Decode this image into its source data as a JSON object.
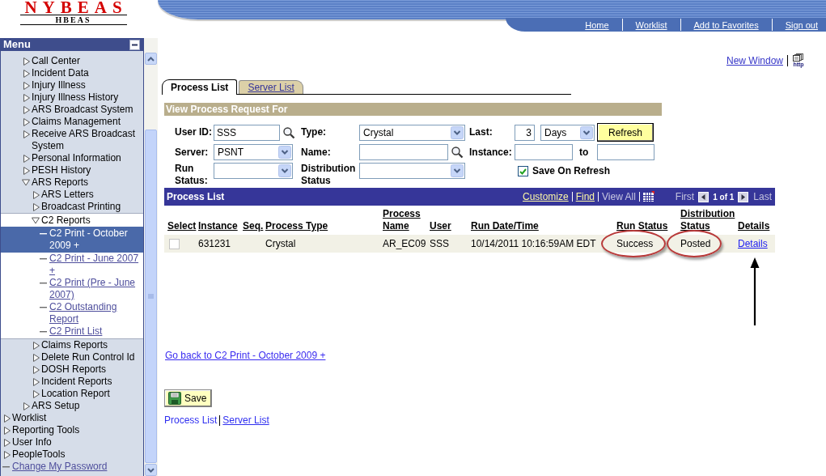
{
  "header": {
    "logo_title": "NYBEAS",
    "logo_subtitle": "HBEAS",
    "nav_links": [
      "Home",
      "Worklist",
      "Add to Favorites",
      "Sign out"
    ]
  },
  "sidebar": {
    "title": "Menu",
    "items": [
      {
        "children": [
          {
            "label": "Call Center",
            "kind": "folder",
            "expanded": false,
            "selected": false
          },
          {
            "label": "Incident Data",
            "kind": "folder",
            "expanded": false,
            "selected": false
          },
          {
            "label": "Injury Illness",
            "kind": "folder",
            "expanded": false,
            "selected": false
          },
          {
            "label": "Injury Illness History",
            "kind": "folder",
            "expanded": false,
            "selected": false
          },
          {
            "label": "ARS Broadcast System",
            "kind": "folder",
            "expanded": false,
            "selected": false
          },
          {
            "label": "Claims Management",
            "kind": "folder",
            "expanded": false,
            "selected": false
          },
          {
            "label": "Receive ARS Broadcast System",
            "kind": "folder",
            "expanded": false,
            "selected": false
          },
          {
            "label": "Personal Information",
            "kind": "folder",
            "expanded": false,
            "selected": false
          },
          {
            "label": "PESH History",
            "kind": "folder",
            "expanded": false,
            "selected": false
          },
          {
            "label": "ARS Reports",
            "kind": "folder",
            "expanded": true,
            "selected": false,
            "children": [
              {
                "label": "ARS Letters",
                "kind": "folder",
                "expanded": false,
                "selected": false
              },
              {
                "label": "Broadcast Printing",
                "kind": "folder",
                "expanded": false,
                "selected": false
              },
              {
                "label": "C2 Reports",
                "kind": "folder",
                "expanded": true,
                "selected": false,
                "children": [
                  {
                    "label": "C2 Print - October 2009 +",
                    "kind": "link",
                    "selected": true
                  },
                  {
                    "label": "C2 Print - June 2007 +",
                    "kind": "link",
                    "selected": false
                  },
                  {
                    "label": "C2 Print (Pre - June 2007)",
                    "kind": "link",
                    "selected": false
                  },
                  {
                    "label": "C2 Outstanding Report",
                    "kind": "link",
                    "selected": false
                  },
                  {
                    "label": "C2 Print List",
                    "kind": "link",
                    "selected": false
                  }
                ]
              },
              {
                "label": "Claims Reports",
                "kind": "folder",
                "expanded": false,
                "selected": false
              },
              {
                "label": "Delete Run Control Id",
                "kind": "folder",
                "expanded": false,
                "selected": false
              },
              {
                "label": "DOSH Reports",
                "kind": "folder",
                "expanded": false,
                "selected": false
              },
              {
                "label": "Incident Reports",
                "kind": "folder",
                "expanded": false,
                "selected": false
              },
              {
                "label": "Location Report",
                "kind": "folder",
                "expanded": false,
                "selected": false
              }
            ]
          },
          {
            "label": "ARS Setup",
            "kind": "folder",
            "expanded": false,
            "selected": false
          }
        ]
      },
      {
        "label": "Worklist",
        "kind": "folder",
        "expanded": false,
        "selected": false
      },
      {
        "label": "Reporting Tools",
        "kind": "folder",
        "expanded": false,
        "selected": false
      },
      {
        "label": "User Info",
        "kind": "folder",
        "expanded": false,
        "selected": false
      },
      {
        "label": "PeopleTools",
        "kind": "folder",
        "expanded": false,
        "selected": false
      },
      {
        "label": "Change My Password",
        "kind": "link",
        "selected": false
      }
    ]
  },
  "new_window_link": "New Window",
  "http_link": "http",
  "tabs": [
    {
      "label": "Process List",
      "selected": true
    },
    {
      "label": "Server List",
      "selected": false
    }
  ],
  "filter_panel": {
    "title": "View Process Request For",
    "user_id": {
      "label": "User ID:",
      "value": "SSS"
    },
    "type": {
      "label": "Type:",
      "value": "Crystal"
    },
    "last": {
      "label": "Last:",
      "value": "3",
      "unit": "Days"
    },
    "refresh_button": "Refresh",
    "server": {
      "label": "Server:",
      "value": "PSNT"
    },
    "name": {
      "label": "Name:"
    },
    "instance": {
      "label": "Instance:",
      "to_label": "to"
    },
    "run_status": {
      "label": "Run Status:"
    },
    "distribution_status": {
      "label": "Distribution Status"
    },
    "save_on_refresh": {
      "label": "Save On Refresh",
      "checked": true
    }
  },
  "process_grid": {
    "title": "Process List",
    "tools": [
      {
        "label": "Customize",
        "disabled": false
      },
      {
        "label": "Find",
        "disabled": false
      },
      {
        "label": "View All",
        "disabled": true
      }
    ],
    "pager": {
      "first": {
        "label": "First",
        "disabled": true
      },
      "count": "1 of 1",
      "last": {
        "label": "Last",
        "disabled": true
      }
    },
    "columns": [
      "Select",
      "Instance",
      "Seq.",
      "Process Type",
      "Process Name",
      "User",
      "Run Date/Time",
      "Run Status",
      "Distribution Status",
      "Details"
    ],
    "rows": [
      {
        "selected": false,
        "instance": "631231",
        "process_type": "Crystal",
        "process_name": "AR_EC09",
        "user": "SSS",
        "run_date_time": "10/14/2011 10:16:59AM EDT",
        "run_status": {
          "text": "Success",
          "circled": true
        },
        "distribution_status": {
          "text": "Posted",
          "circled": true
        },
        "details": {
          "text": "Details",
          "pointed": true
        }
      }
    ]
  },
  "back_link": "Go back to C2 Print - October 2009 +",
  "save_button": "Save",
  "footer_links": [
    {
      "label": "Process List",
      "selected": true
    },
    {
      "label": "Server List",
      "selected": false
    }
  ]
}
